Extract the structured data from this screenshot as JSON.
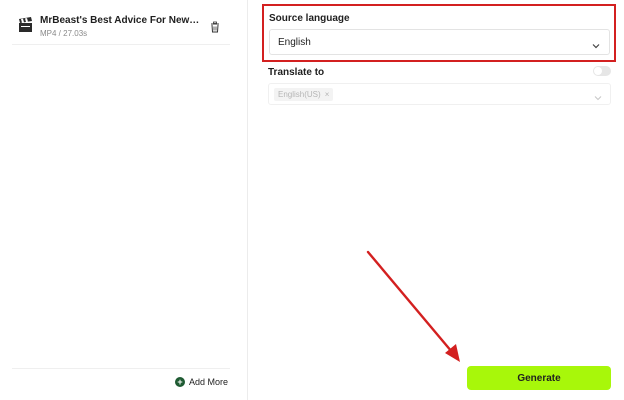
{
  "files": [
    {
      "title": "MrBeast's Best Advice For New YouTu...",
      "meta": "MP4 / 27.03s",
      "icon": "clapperboard-icon"
    }
  ],
  "left_footer": {
    "add_more_label": "Add More",
    "add_icon": "plus-circle-icon"
  },
  "source": {
    "label": "Source language",
    "value": "English"
  },
  "translate": {
    "label": "Translate to",
    "toggle_on": false,
    "tag": "English(US)",
    "tag_remove": "×"
  },
  "generate": {
    "label": "Generate"
  },
  "colors": {
    "accent": "#a8f70a",
    "highlight_box": "#d32020",
    "annotation_arrow": "#d32020",
    "add_icon": "#1e5a32"
  }
}
